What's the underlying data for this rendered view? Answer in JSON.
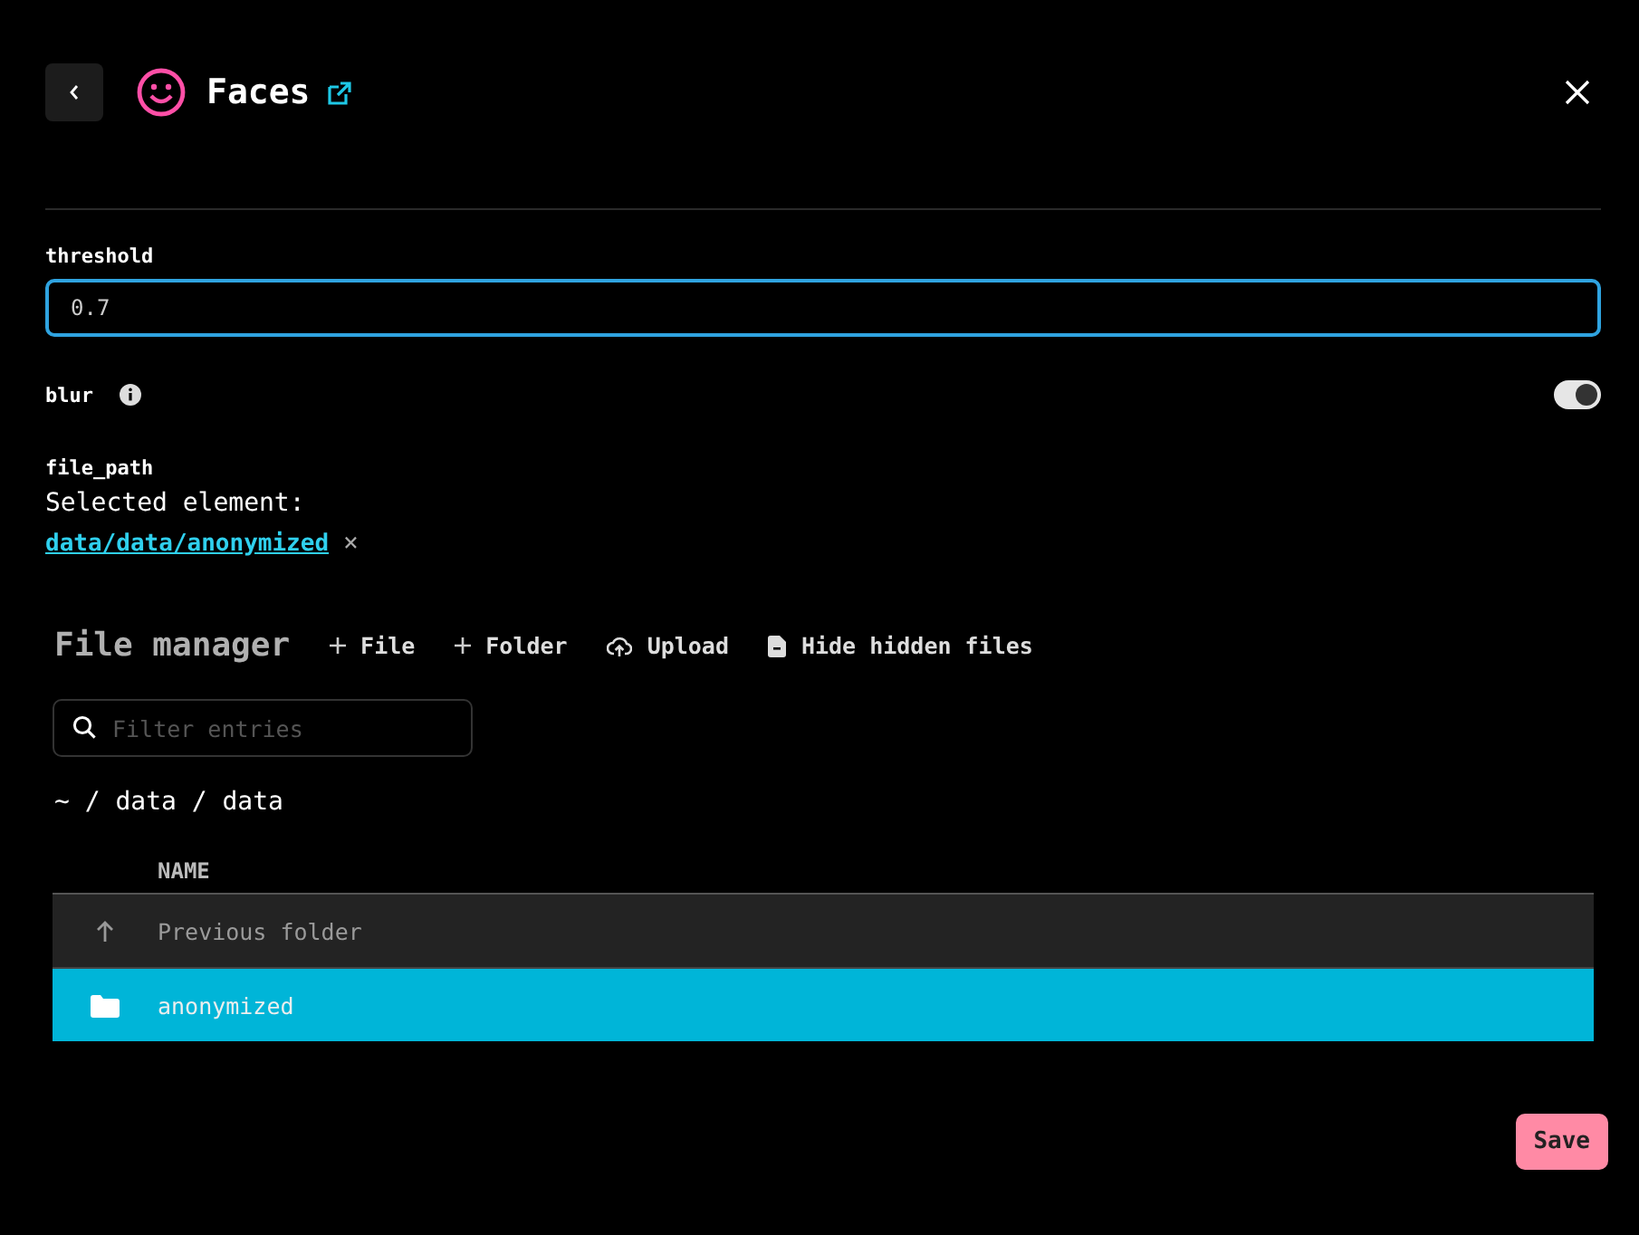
{
  "header": {
    "title": "Faces"
  },
  "fields": [
    {
      "kind": "text",
      "label": "threshold",
      "value": "0.7",
      "focused": true
    },
    {
      "kind": "toggle",
      "label": "blur",
      "info": true,
      "on": true
    }
  ],
  "file_path": {
    "label": "file_path",
    "caption": "Selected element:",
    "selected_path": "data/data/anonymized",
    "remove": "×"
  },
  "file_manager": {
    "title": "File manager",
    "actions": [
      {
        "kind": "add",
        "label": "File"
      },
      {
        "kind": "add",
        "label": "Folder"
      },
      {
        "kind": "upload",
        "label": "Upload"
      },
      {
        "kind": "hide",
        "label": "Hide hidden files"
      }
    ],
    "filter": {
      "placeholder": "Filter entries"
    },
    "breadcrumb": "~ / data / data",
    "columns": [
      "NAME"
    ],
    "rows": [
      {
        "kind": "parent",
        "name": "Previous folder",
        "selected": false
      },
      {
        "kind": "folder",
        "name": "anonymized",
        "selected": true
      }
    ]
  },
  "buttons": [
    {
      "label": "Save"
    }
  ]
}
